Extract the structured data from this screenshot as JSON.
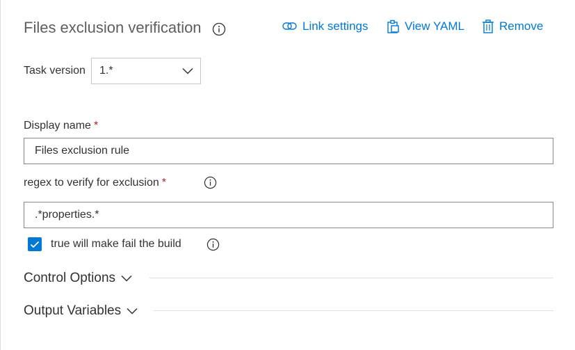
{
  "task": {
    "title": "Files exclusion verification"
  },
  "toolbar": {
    "link_settings": "Link settings",
    "view_yaml": "View YAML",
    "remove": "Remove"
  },
  "task_version": {
    "label": "Task version",
    "selected": "1.*"
  },
  "display_name": {
    "label": "Display name",
    "required_marker": "*",
    "value": "Files exclusion rule"
  },
  "regex": {
    "label": "regex to verify for exclusion",
    "required_marker": "*",
    "value": ".*properties.*"
  },
  "fail_build": {
    "label": "true will make fail the build",
    "checked": true
  },
  "sections": {
    "control_options": "Control Options",
    "output_variables": "Output Variables"
  },
  "colors": {
    "accent": "#0078d4",
    "required": "#a4262c",
    "title": "#605e5c"
  },
  "icons": [
    "info-icon",
    "link-icon",
    "clipboard-icon",
    "trash-icon",
    "chevron-down-icon",
    "checkmark-icon"
  ]
}
